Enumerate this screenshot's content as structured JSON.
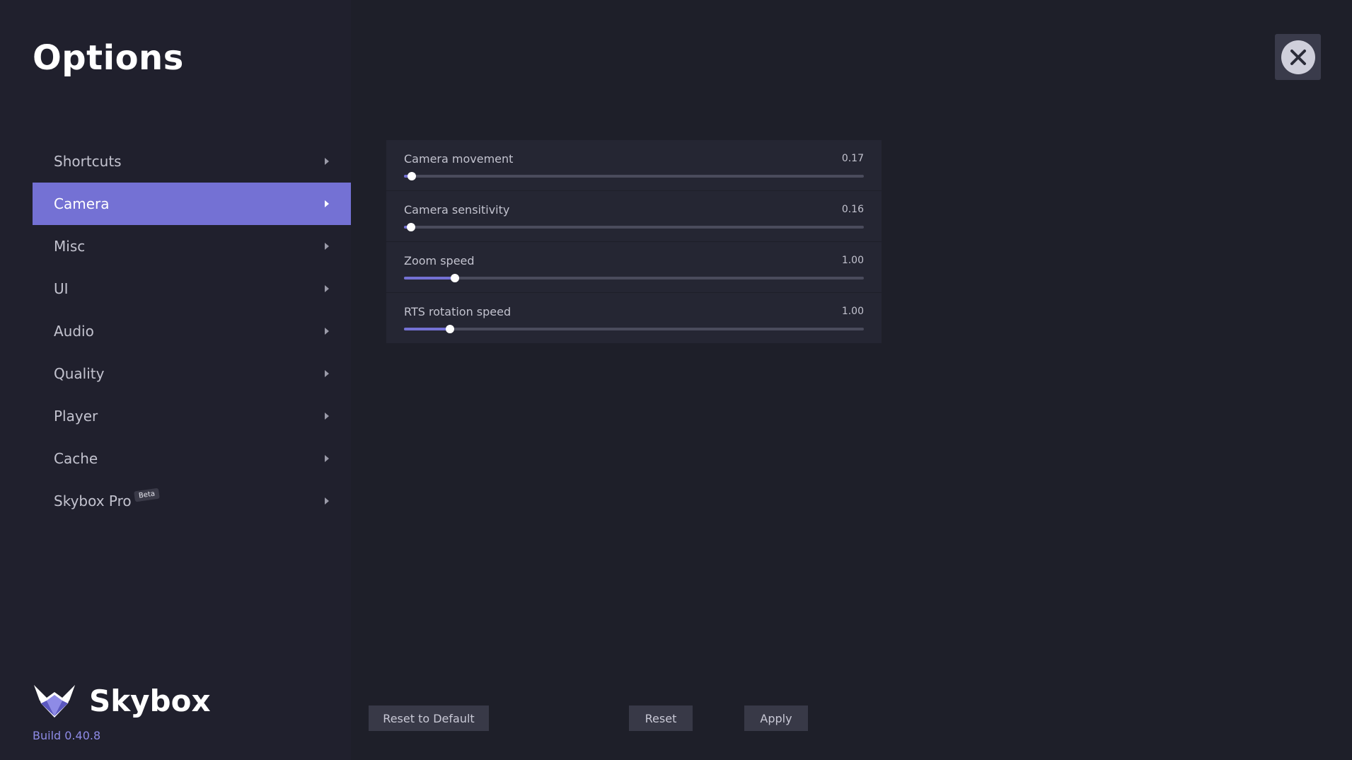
{
  "title": "Options",
  "nav": [
    {
      "label": "Shortcuts",
      "active": false
    },
    {
      "label": "Camera",
      "active": true
    },
    {
      "label": "Misc",
      "active": false
    },
    {
      "label": "UI",
      "active": false
    },
    {
      "label": "Audio",
      "active": false
    },
    {
      "label": "Quality",
      "active": false
    },
    {
      "label": "Player",
      "active": false
    },
    {
      "label": "Cache",
      "active": false
    },
    {
      "label": "Skybox Pro",
      "active": false,
      "badge": "Beta"
    }
  ],
  "brand": {
    "name": "Skybox",
    "build": "Build 0.40.8",
    "logo_icon": "fox-logo-icon"
  },
  "close_icon": "close-icon",
  "settings": [
    {
      "label": "Camera movement",
      "value": "0.17",
      "fraction": 0.017
    },
    {
      "label": "Camera sensitivity",
      "value": "0.16",
      "fraction": 0.015
    },
    {
      "label": "Zoom speed",
      "value": "1.00",
      "fraction": 0.11
    },
    {
      "label": "RTS rotation speed",
      "value": "1.00",
      "fraction": 0.1
    }
  ],
  "buttons": {
    "reset_default": "Reset to Default",
    "reset": "Reset",
    "apply": "Apply"
  },
  "colors": {
    "accent": "#7471d4",
    "sidebar_bg": "#20202d",
    "main_bg": "#1e1f29"
  }
}
